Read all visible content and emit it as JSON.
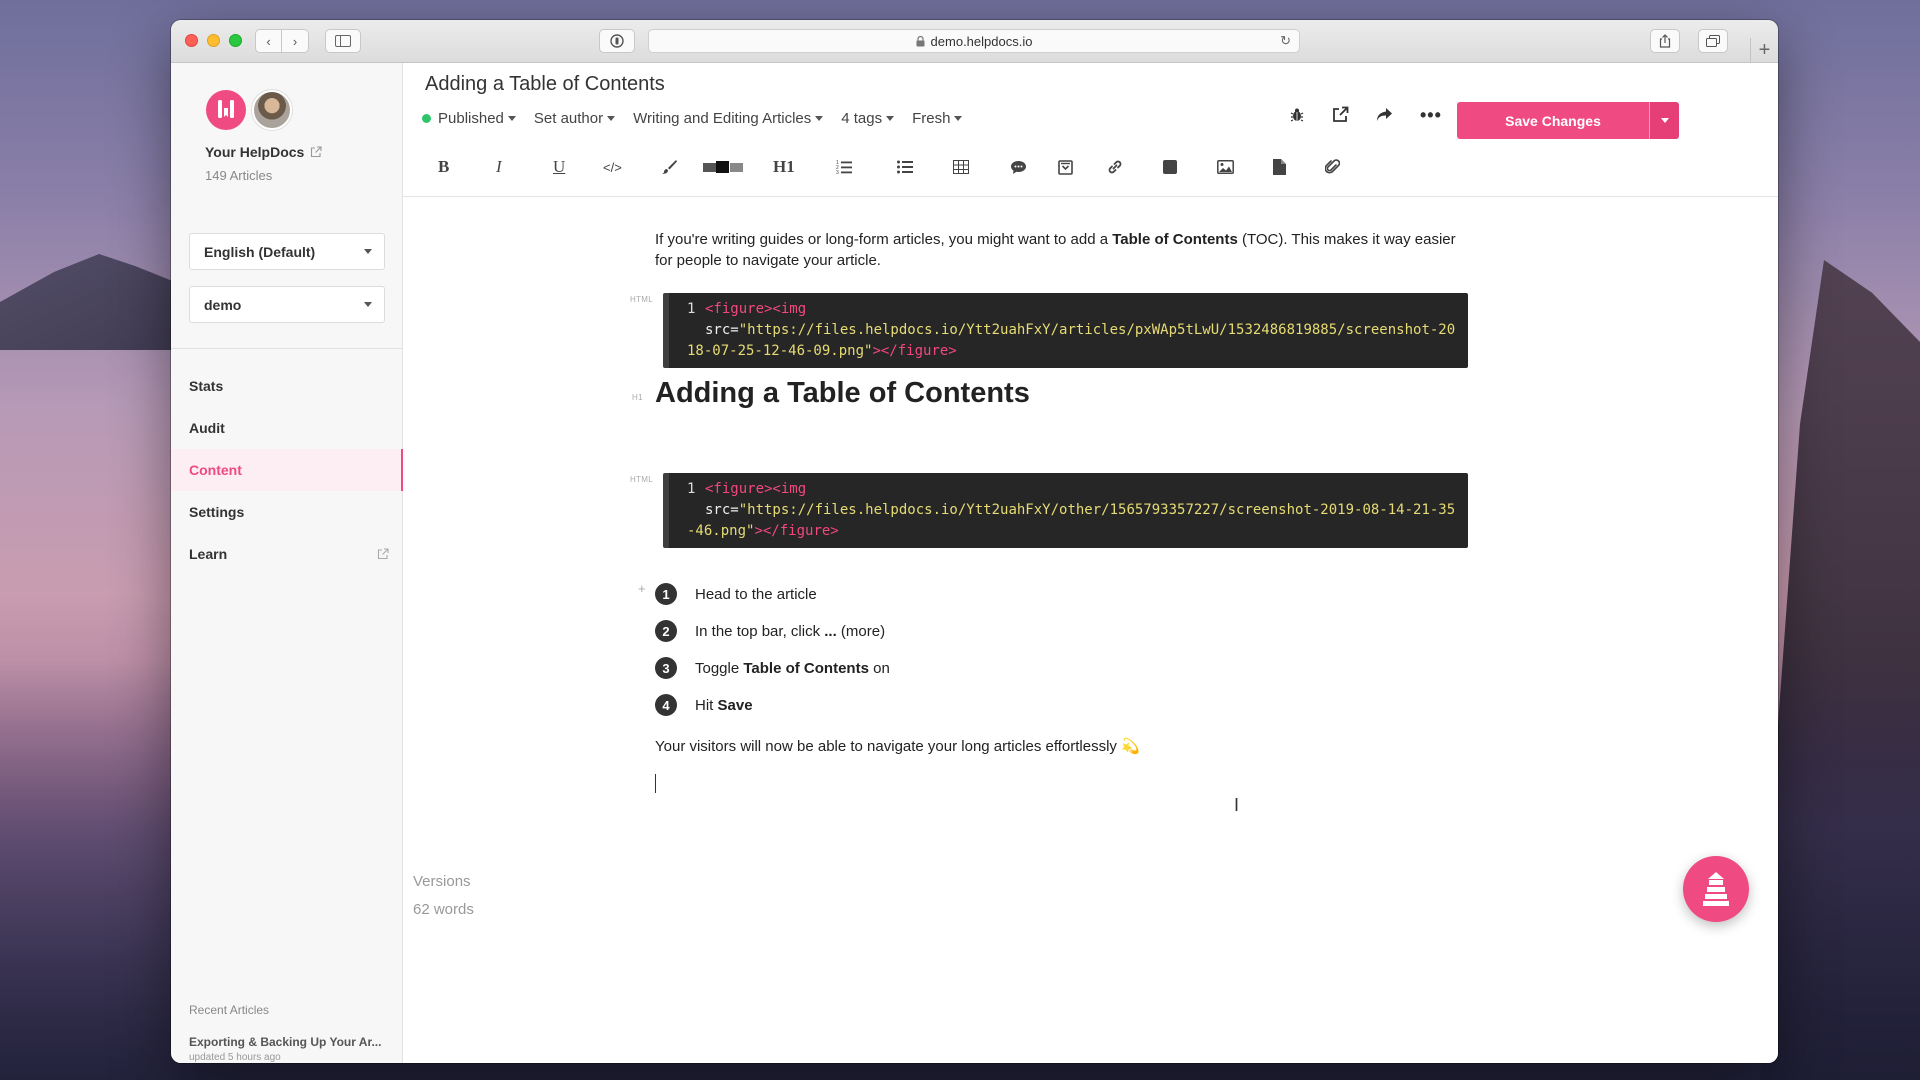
{
  "browser": {
    "url": "demo.helpdocs.io"
  },
  "sidebar": {
    "org_name": "Your HelpDocs",
    "article_count": "149 Articles",
    "language": "English (Default)",
    "site": "demo",
    "nav": [
      {
        "label": "Stats"
      },
      {
        "label": "Audit"
      },
      {
        "label": "Content"
      },
      {
        "label": "Settings"
      },
      {
        "label": "Learn"
      }
    ],
    "recent_title": "Recent Articles",
    "recent_item": "Exporting & Backing Up Your Ar...",
    "recent_meta": "updated 5 hours ago"
  },
  "editor": {
    "title": "Adding a Table of Contents",
    "status": "Published",
    "author": "Set author",
    "category": "Writing and Editing Articles",
    "tags": "4 tags",
    "freshness": "Fresh",
    "save_label": "Save Changes",
    "toolbar": {
      "bold": "B",
      "italic": "I",
      "underline": "U",
      "code": "</>",
      "heading": "H1"
    }
  },
  "content": {
    "intro_before": "If you're writing guides or long-form articles, you might want to add a ",
    "intro_bold": "Table of Contents",
    "intro_after": " (TOC). This makes it way easier for people to navigate your article.",
    "code_tag_label": "HTML",
    "code1": {
      "line": "1",
      "open": "<figure><img",
      "attr": "src=",
      "value": "\"https://files.helpdocs.io/Ytt2uahFxY/articles/pxWAp5tLwU/1532486819885/screenshot-2018-07-25-12-46-09.png\"",
      "close": "></figure>"
    },
    "h1_label": "H1",
    "heading": "Adding a Table of Contents",
    "code2": {
      "line": "1",
      "open": "<figure><img",
      "attr": "src=",
      "value": "\"https://files.helpdocs.io/Ytt2uahFxY/other/1565793357227/screenshot-2019-08-14-21-35-46.png\"",
      "close": "></figure>"
    },
    "steps": [
      {
        "num": "1",
        "pre": "Head to the article",
        "bold": "",
        "post": ""
      },
      {
        "num": "2",
        "pre": "In the top bar, click ",
        "bold": "...",
        "post": " (more)"
      },
      {
        "num": "3",
        "pre": "Toggle ",
        "bold": "Table of Contents",
        "post": " on"
      },
      {
        "num": "4",
        "pre": "Hit ",
        "bold": "Save",
        "post": ""
      }
    ],
    "outro": "Your visitors will now be able to navigate your long articles effortlessly 💫"
  },
  "footer": {
    "versions": "Versions",
    "words": "62 words"
  },
  "colors": {
    "accent": "#ef4a82",
    "published": "#2ec46b"
  }
}
